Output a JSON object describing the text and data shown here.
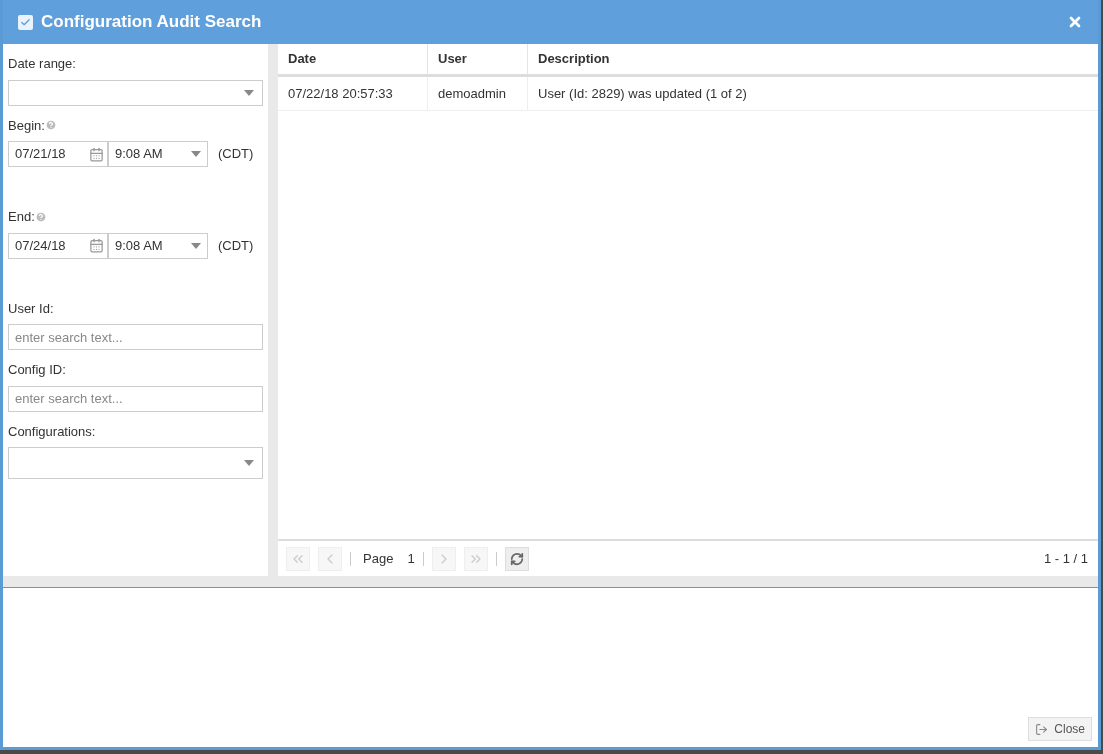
{
  "window": {
    "title": "Configuration Audit Search",
    "checked": true
  },
  "filters": [
    {
      "kind": "select",
      "label": "Date range:"
    },
    {
      "kind": "datetime",
      "label": "Begin:",
      "help": true,
      "date": "07/21/18",
      "time": "9:08 AM",
      "zone": "(CDT)"
    },
    {
      "kind": "datetime",
      "label": "End:",
      "help": true,
      "date": "07/24/18",
      "time": "9:08 AM",
      "zone": "(CDT)"
    },
    {
      "kind": "text",
      "label": "User Id:",
      "placeholder": "enter search text..."
    },
    {
      "kind": "text",
      "label": "Config ID:",
      "placeholder": "enter search text..."
    },
    {
      "kind": "select",
      "label": "Configurations:"
    }
  ],
  "table": {
    "columns": [
      "Date",
      "User",
      "Description"
    ],
    "rows": [
      [
        "07/22/18 20:57:33",
        "demoadmin",
        "User (Id: 2829) was updated (1 of 2)"
      ]
    ]
  },
  "pager": {
    "page_label": "Page",
    "page": "1",
    "summary": "1 - 1 / 1"
  },
  "footer": {
    "close": "Close"
  }
}
